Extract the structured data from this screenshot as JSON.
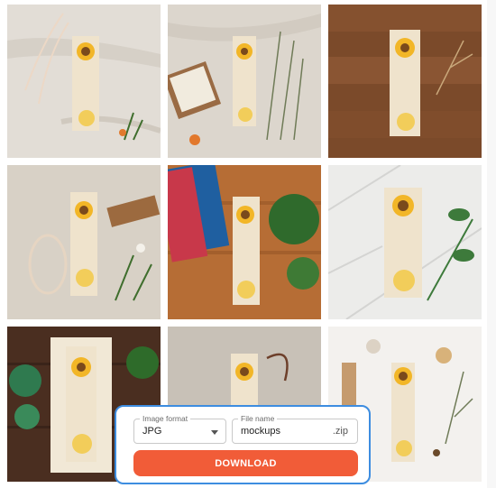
{
  "gallery": {
    "tiles": [
      {
        "scene": "white fabric background with ribbon and sunflower bookmark"
      },
      {
        "scene": "white fabric background with open book and dried flowers"
      },
      {
        "scene": "wooden table with bookmark and dried flower sprig"
      },
      {
        "scene": "beige linen background with ribbon, closed book and white flowers"
      },
      {
        "scene": "wooden desk with books and green plant"
      },
      {
        "scene": "white marble surface with leafy branch"
      },
      {
        "scene": "dark wood table with open book and succulents"
      },
      {
        "scene": "beige surface with bookmark and ribbon"
      },
      {
        "scene": "white flatlay with stationery and dried plant"
      }
    ]
  },
  "export": {
    "format_label": "Image format",
    "format_value": "JPG",
    "filename_label": "File name",
    "filename_value": "mockups",
    "filename_suffix": ".zip",
    "download_label": "DOWNLOAD"
  },
  "colors": {
    "accent_button": "#f15c38",
    "panel_border": "#3d8de0"
  }
}
